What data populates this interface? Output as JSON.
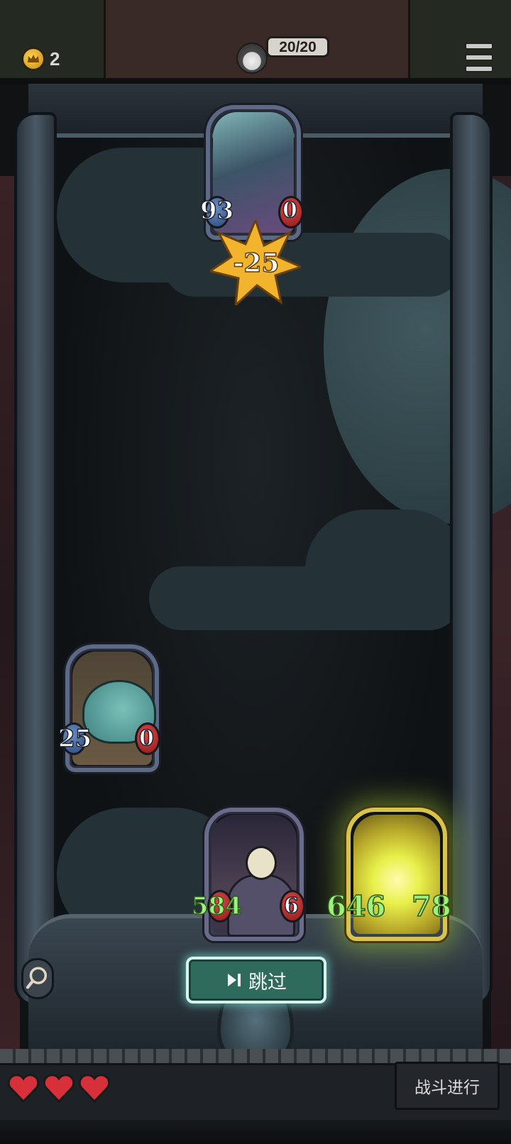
{
  "top_bar": {
    "coins": "2",
    "hero_hp": "20/20"
  },
  "enemy_card": {
    "attack": "93",
    "health": "0",
    "damage_popup": "-25"
  },
  "beast_card": {
    "attack": "25",
    "health": "0"
  },
  "reaper_card": {
    "attack": "584",
    "health": "6"
  },
  "gold_card": {
    "attack": "646",
    "health": "78"
  },
  "skip_button": {
    "label": "跳过"
  },
  "footer": {
    "lives_total": 3,
    "lives_remaining": 3,
    "battle_label": "战斗进行"
  },
  "colors": {
    "skip_button": "#2e6b5c",
    "heart": "#d8303a",
    "attack_orb": "#4c6fa8",
    "health_orb": "#c42828",
    "buff_number": "#9cf27a"
  }
}
